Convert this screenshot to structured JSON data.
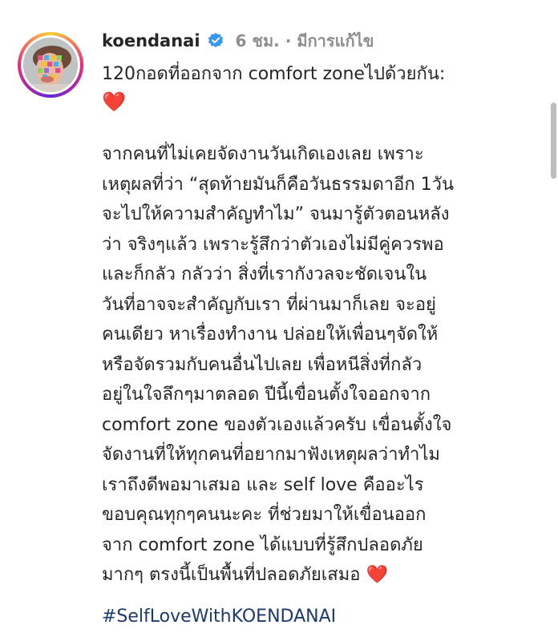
{
  "post": {
    "username": "koendanai",
    "time_ago": "6 ชม.",
    "separator": "·",
    "edited_label": "มีการแก้ไข",
    "caption_title": "120กอดที่ออกจาก comfort zoneไปด้วยกัน:",
    "caption_heart": "❤️",
    "body_lines": [
      "จากคนที่ไม่เคยจัดงานวันเกิดเองเลย เพราะ",
      "เหตุผลที่ว่า “สุดท้ายมันก็คือวันธรรมดาอีก 1วัน",
      "จะไปให้ความสำคัญทำไม” จนมารู้ตัวตอนหลัง",
      "ว่า จริงๆแล้ว เพราะรู้สึกว่าตัวเองไม่มีคู่ควรพอ",
      "และก็กลัว กลัวว่า สิ่งที่เรากังวลจะชัดเจนใน",
      "วันที่อาจจะสำคัญกับเรา ที่ผ่านมาก็เลย จะอยู่",
      "คนเดียว หาเรื่องทำงาน ปล่อยให้เพื่อนๆจัดให้",
      "หรือจัดรวมกับคนอื่นไปเลย เพื่อหนีสิ่งที่กลัว",
      "อยู่ในใจลึกๆมาตลอด ปีนี้เขื่อนตั้งใจออกจาก",
      "comfort zone ของตัวเองแล้วครับ เขื่อนตั้งใจ",
      "จัดงานที่ให้ทุกคนที่อยากมาฟังเหตุผลว่าทำไม",
      "เราถึงดีพอมาเสมอ และ self love คืออะไร",
      "ขอบคุณทุกๆคนนะคะ ที่ช่วยมาให้เขื่อนออก",
      "จาก comfort zone ได้แบบที่รู้สึกปลอดภัย"
    ],
    "last_line": "มากๆ ตรงนี้เป็นพื้นที่ปลอดภัยเสมอ",
    "last_line_heart": "❤️",
    "hashtag": "#SelfLoveWithKOENDANAI"
  },
  "icons": {
    "verified": "verified-badge-icon",
    "heart": "red-heart-emoji"
  },
  "colors": {
    "verified_blue": "#3797f0",
    "hashtag": "#1c3a6b",
    "muted": "#8e8e8e",
    "heart": "#e53935"
  }
}
